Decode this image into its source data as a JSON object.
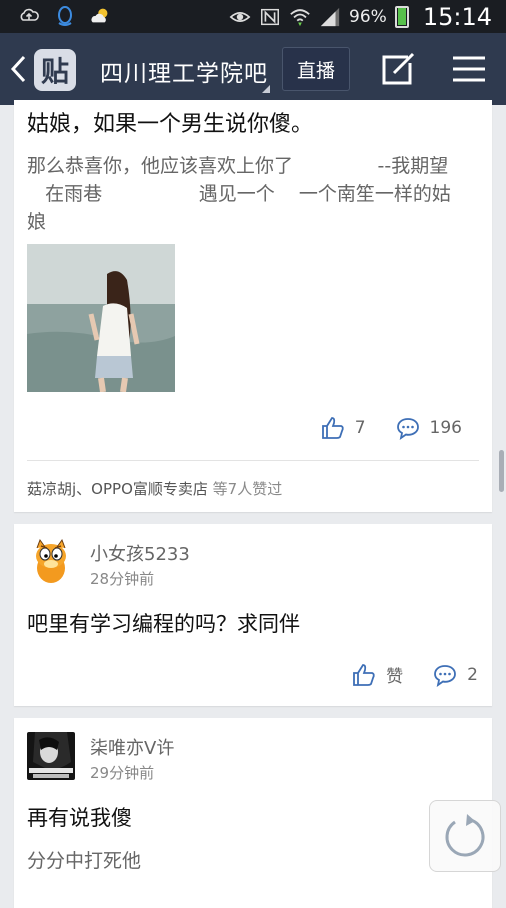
{
  "status_bar": {
    "battery_percent": "96%",
    "battery_level": 0.96,
    "time": "15:14"
  },
  "navbar": {
    "logo_glyph": "贴",
    "title": "四川理工学院吧",
    "live_label": "直播"
  },
  "posts": [
    {
      "title": "姑娘，如果一个男生说你傻。",
      "body": "那么恭喜你，他应该喜欢上你了              --我期望\n   在雨巷                遇见一个    一个南笙一样的姑\n娘",
      "likes": "7",
      "comments": "196",
      "likers": "菇凉胡j、OPPO富顺专卖店",
      "likers_suffix": "等7人赞过"
    },
    {
      "username": "小女孩5233",
      "time": "28分钟前",
      "title": "吧里有学习编程的吗？求同伴",
      "like_label": "赞",
      "comments": "2"
    },
    {
      "username": "柒唯亦V许",
      "time": "29分钟前",
      "title": "再有说我傻",
      "body": "分分中打死他"
    }
  ],
  "colors": {
    "navbar_bg": "#2f3a4f",
    "statusbar_bg": "#1a1d22",
    "action_blue": "#3e6fb6",
    "page_bg": "#e9ebee"
  },
  "icons": {
    "back": "chevron-left-icon",
    "edit": "edit-icon",
    "menu": "menu-icon",
    "like": "thumbs-up-icon",
    "comment": "comment-icon",
    "refresh": "refresh-icon"
  }
}
